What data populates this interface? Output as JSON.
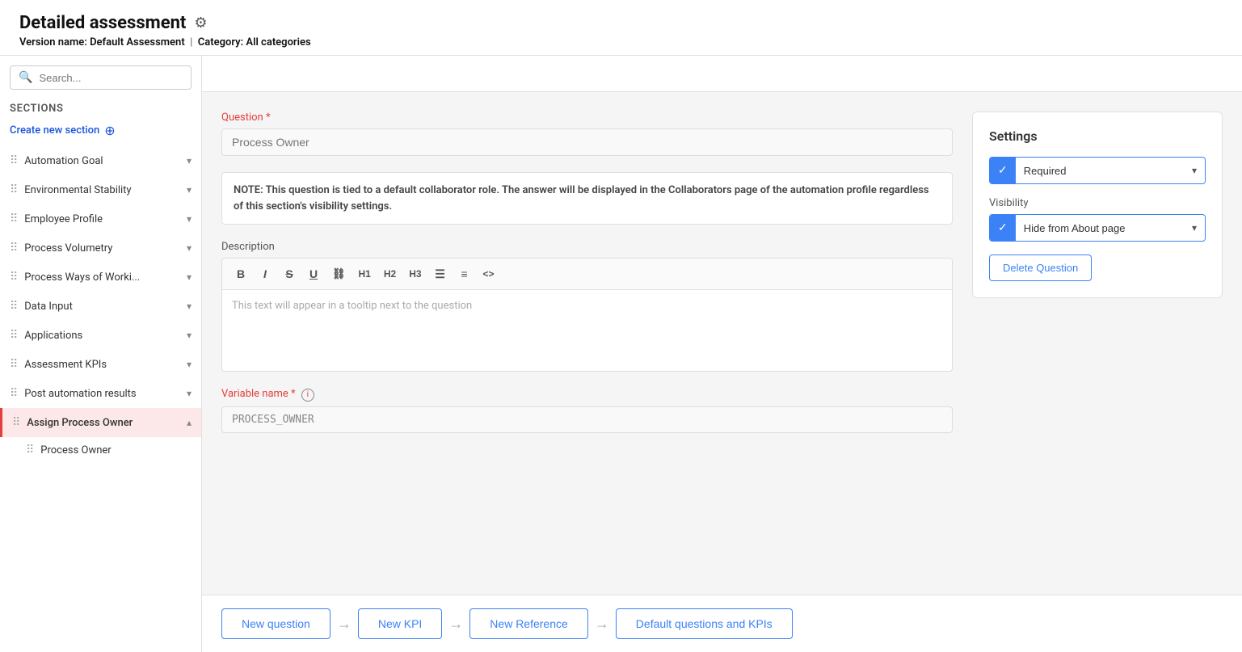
{
  "header": {
    "title": "Detailed assessment",
    "version_label": "Version name:",
    "version_name": "Default Assessment",
    "category_label": "Category:",
    "category_value": "All categories"
  },
  "sidebar": {
    "search_placeholder": "Search...",
    "sections_label": "Sections",
    "create_new_section": "Create new section",
    "items": [
      {
        "id": "automation-goal",
        "label": "Automation Goal",
        "active": false,
        "expanded": false
      },
      {
        "id": "environmental-stability",
        "label": "Environmental Stability",
        "active": false,
        "expanded": false
      },
      {
        "id": "employee-profile",
        "label": "Employee Profile",
        "active": false,
        "expanded": false
      },
      {
        "id": "process-volumetry",
        "label": "Process Volumetry",
        "active": false,
        "expanded": false
      },
      {
        "id": "process-ways-of-working",
        "label": "Process Ways of Worki...",
        "active": false,
        "expanded": false
      },
      {
        "id": "data-input",
        "label": "Data Input",
        "active": false,
        "expanded": false
      },
      {
        "id": "applications",
        "label": "Applications",
        "active": false,
        "expanded": false
      },
      {
        "id": "assessment-kpis",
        "label": "Assessment KPIs",
        "active": false,
        "expanded": false
      },
      {
        "id": "post-automation-results",
        "label": "Post automation results",
        "active": false,
        "expanded": false
      },
      {
        "id": "assign-process-owner",
        "label": "Assign Process Owner",
        "active": true,
        "expanded": true
      }
    ],
    "sub_items": [
      {
        "id": "process-owner",
        "label": "Process Owner"
      }
    ]
  },
  "form": {
    "question_label": "Question *",
    "question_placeholder": "Process Owner",
    "note_text": "NOTE: This question is tied to a default collaborator role. The answer will be displayed in the Collaborators page of the automation profile regardless of this section's visibility settings.",
    "description_label": "Description",
    "description_placeholder": "This text will appear in a tooltip next to the question",
    "variable_name_label": "Variable name *",
    "variable_name_value": "PROCESS_OWNER",
    "toolbar": {
      "bold": "B",
      "italic": "I",
      "strikethrough": "S",
      "underline": "U",
      "link": "🔗",
      "h1": "H1",
      "h2": "H2",
      "h3": "H3",
      "bullet_list": "≡",
      "ordered_list": "≣",
      "code": "<>"
    }
  },
  "settings": {
    "title": "Settings",
    "required_label": "Required",
    "visibility_label": "Visibility",
    "visibility_value": "Hide from About page",
    "delete_button_label": "Delete Question"
  },
  "action_bar": {
    "new_question": "New question",
    "new_kpi": "New KPI",
    "new_reference": "New Reference",
    "default_questions": "Default questions and KPIs"
  }
}
